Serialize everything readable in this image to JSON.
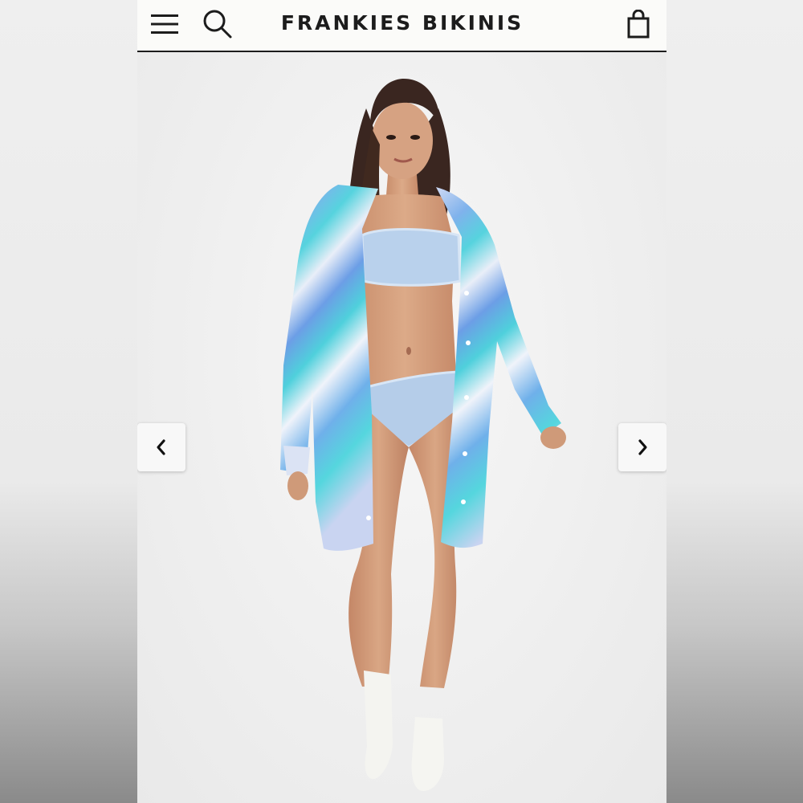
{
  "header": {
    "brand": "FRANKIES BIKINIS",
    "menu_icon": "hamburger-menu-icon",
    "search_icon": "search-icon",
    "bag_icon": "shopping-bag-icon"
  },
  "gallery": {
    "prev_icon": "chevron-left-icon",
    "next_icon": "chevron-right-icon"
  },
  "colors": {
    "header_bg": "#fbfbf9",
    "text": "#1c1c1c",
    "photo_bg": "#efefef",
    "cardigan_blue": "#6fa8e6",
    "cardigan_aqua": "#55d1dd",
    "bikini": "#b9d1ec"
  }
}
